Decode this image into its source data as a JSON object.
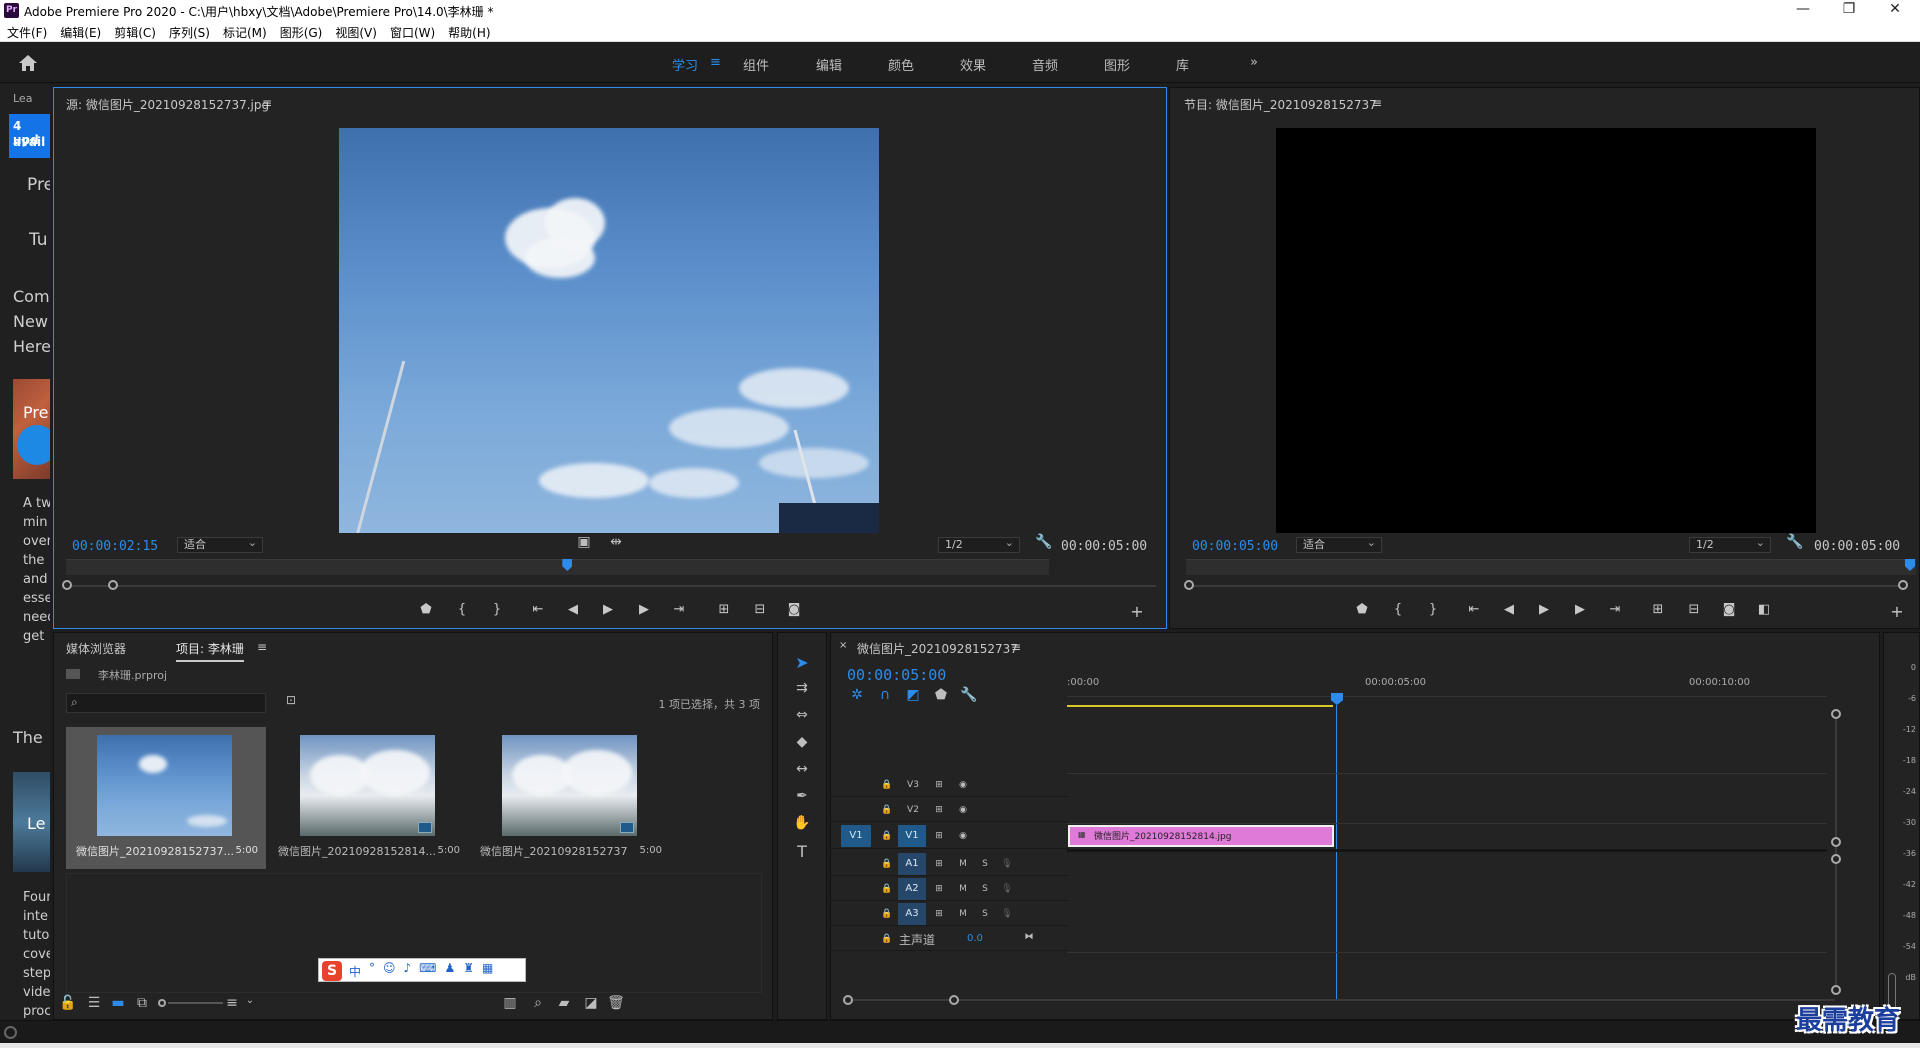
{
  "window": {
    "title": "Adobe Premiere Pro 2020 - C:\\用户\\hbxy\\文档\\Adobe\\Premiere Pro\\14.0\\李林珊 *",
    "icon": "Pr"
  },
  "menu": [
    "文件(F)",
    "编辑(E)",
    "剪辑(C)",
    "序列(S)",
    "标记(M)",
    "图形(G)",
    "视图(V)",
    "窗口(W)",
    "帮助(H)"
  ],
  "workspaces": {
    "items": [
      "学习",
      "组件",
      "编辑",
      "颜色",
      "效果",
      "音频",
      "图形",
      "库"
    ],
    "active": "学习",
    "more": "»"
  },
  "learn": {
    "header": "Lea",
    "update": "4 upd",
    "update2": "avail",
    "lines": [
      "Pre",
      "Tu",
      "Com",
      "New",
      "Here",
      "Pre",
      "A tw",
      "min",
      "over",
      "the",
      "and",
      "esse",
      "need",
      "get :",
      "The",
      "Le",
      "Four",
      "inte",
      "tuto",
      "cove",
      "step",
      "vide",
      "proc"
    ]
  },
  "source": {
    "title": "源: 微信图片_20210928152737.jpg",
    "timecode": "00:00:02:15",
    "fit": "适合",
    "resolution": "1/2",
    "duration": "00:00:05:00",
    "playhead": 0.51
  },
  "program": {
    "title": "节目: 微信图片_20210928152737",
    "timecode": "00:00:05:00",
    "fit": "适合",
    "resolution": "1/2",
    "duration": "00:00:05:00"
  },
  "project": {
    "tabs": [
      "媒体浏览器",
      "项目: 李林珊"
    ],
    "file": "李林珊.prproj",
    "selection": "1 项已选择，共 3 项",
    "items": [
      {
        "name": "微信图片_20210928152737...",
        "duration": "5:00",
        "selected": true
      },
      {
        "name": "微信图片_20210928152814...",
        "duration": "5:00",
        "selected": false
      },
      {
        "name": "微信图片_20210928152737",
        "duration": "5:00",
        "selected": false
      }
    ]
  },
  "timeline": {
    "title": "微信图片_20210928152737",
    "timecode": "00:00:05:00",
    "ruler": [
      ":00:00",
      "00:00:05:00",
      "00:00:10:00"
    ],
    "video_tracks": [
      "V3",
      "V2",
      "V1"
    ],
    "audio_tracks": [
      "A1",
      "A2",
      "A3"
    ],
    "source_patch_v": "V1",
    "master": "主声道",
    "master_value": "0.0",
    "clip": "微信图片_20210928152814.jpg",
    "mute": "M",
    "solo": "S"
  },
  "meter": {
    "scale": [
      "0",
      "-6",
      "-12",
      "-18",
      "-24",
      "-30",
      "-36",
      "-42",
      "-48",
      "-54",
      "dB"
    ]
  },
  "ime": {
    "label": "中"
  },
  "watermark": "最需教育",
  "colors": {
    "accent": "#2d8ceb",
    "clip": "#e07ad8",
    "panel": "#232323"
  }
}
